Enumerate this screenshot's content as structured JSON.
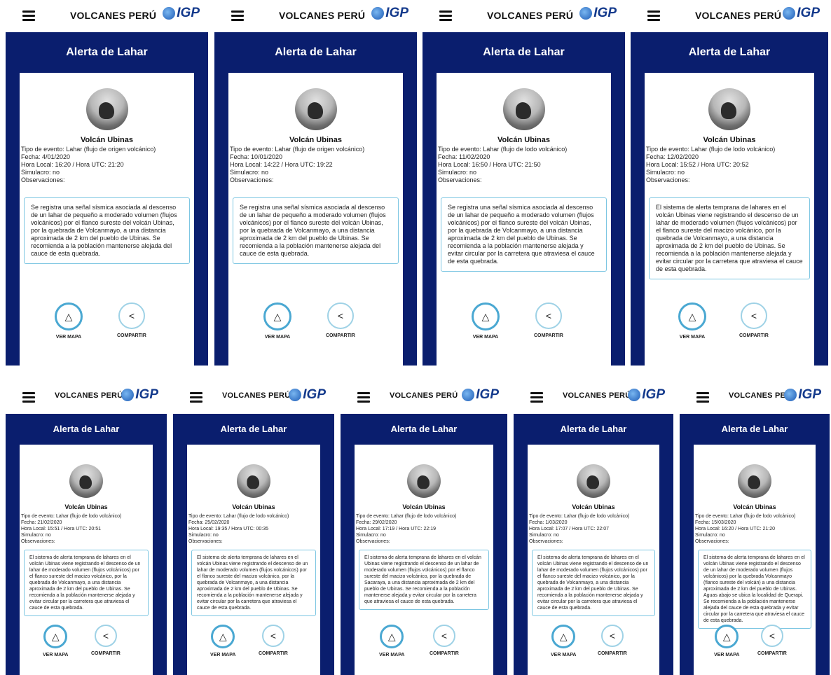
{
  "app": {
    "brand": "VOLCANES PERÚ",
    "logo_text": "IGP",
    "screen_title": "Alerta de Lahar",
    "menu_icon": "menu-icon"
  },
  "labels": {
    "map_button": "VER MAPA",
    "share_button": "COMPARTIR"
  },
  "icons": {
    "map": "map-icon",
    "share": "share-icon"
  },
  "colors": {
    "header_navy": "#0a1e6e",
    "accent": "#4aa8d2",
    "card": "#ffffff"
  },
  "screens": [
    {
      "volcano": "Volcán Ubinas",
      "event": "Tipo de evento: Lahar (flujo de origen volcánico)",
      "date": "Fecha: 4/01/2020",
      "time": "Hora Local: 16:20 / Hora UTC: 21:20",
      "drill": "Simulacro: no",
      "obs_label": "Observaciones:",
      "obs": "Se registra una señal sísmica asociada al descenso de un lahar de pequeño a moderado volumen (flujos volcánicos) por el flanco sureste del volcán Ubinas, por la quebrada de Volcanmayo, a una distancia aproximada de 2 km del pueblo de Ubinas. Se recomienda a la población mantenerse alejada del cauce de esta quebrada."
    },
    {
      "volcano": "Volcán Ubinas",
      "event": "Tipo de evento: Lahar (flujo de origen volcánico)",
      "date": "Fecha: 10/01/2020",
      "time": "Hora Local: 14:22 / Hora UTC: 19:22",
      "drill": "Simulacro: no",
      "obs_label": "Observaciones:",
      "obs": "Se registra una señal sísmica asociada al descenso de un lahar de pequeño a moderado volumen (flujos volcánicos) por el flanco sureste del volcán Ubinas, por la quebrada de Volcanmayo, a una distancia aproximada de 2 km del pueblo de Ubinas. Se recomienda a la población mantenerse alejada del cauce de esta quebrada."
    },
    {
      "volcano": "Volcán Ubinas",
      "event": "Tipo de evento: Lahar (flujo de lodo volcánico)",
      "date": "Fecha: 11/02/2020",
      "time": "Hora Local: 16:50 / Hora UTC: 21:50",
      "drill": "Simulacro: no",
      "obs_label": "Observaciones:",
      "obs": "Se registra una señal sísmica asociada al descenso de un lahar de pequeño a moderado volumen (flujos volcánicos) por el flanco sureste del volcán Ubinas, por la quebrada de Volcanmayo, a una distancia aproximada de 2 km del pueblo de Ubinas. Se recomienda a la población mantenerse alejada y evitar circular por la carretera que atraviesa el cauce de esta quebrada."
    },
    {
      "volcano": "Volcán Ubinas",
      "event": "Tipo de evento: Lahar (flujo de lodo volcánico)",
      "date": "Fecha: 12/02/2020",
      "time": "Hora Local: 15:52 / Hora UTC: 20:52",
      "drill": "Simulacro: no",
      "obs_label": "Observaciones:",
      "obs": "El sistema de alerta temprana de lahares en el volcán Ubinas viene registrando el descenso de un lahar de moderado volumen (flujos volcánicos) por el flanco sureste del macizo volcánico, por la quebrada de Volcanmayo, a una distancia aproximada de 2 km del pueblo de Ubinas. Se recomienda a la población mantenerse alejada y evitar circular por la carretera que atraviesa el cauce de esta quebrada."
    },
    {
      "volcano": "Volcán Ubinas",
      "event": "Tipo de evento: Lahar (flujo de lodo volcánico)",
      "date": "Fecha: 21/02/2020",
      "time": "Hora Local: 15:51 / Hora UTC: 20:51",
      "drill": "Simulacro: no",
      "obs_label": "Observaciones:",
      "obs": "El sistema de alerta temprana de lahares en el volcán Ubinas viene registrando el descenso de un lahar de moderado volumen (flujos volcánicos) por el flanco sureste del macizo volcánico, por la quebrada de Volcanmayo, a una distancia aproximada de 2 km del pueblo de Ubinas. Se recomienda a la población mantenerse alejada y evitar circular por la carretera que atraviesa el cauce de esta quebrada."
    },
    {
      "volcano": "Volcán Ubinas",
      "event": "Tipo de evento: Lahar (flujo de lodo volcánico)",
      "date": "Fecha: 25/02/2020",
      "time": "Hora Local: 19:35 / Hora UTC: 00:35",
      "drill": "Simulacro: no",
      "obs_label": "Observaciones:",
      "obs": "El sistema de alerta temprana de lahares en el volcán Ubinas viene registrando el descenso de un lahar de moderado volumen (flujos volcánicos) por el flanco sureste del macizo volcánico, por la quebrada de Volcanmayo, a una distancia aproximada de 2 km del pueblo de Ubinas. Se recomienda a la población mantenerse alejada y evitar circular por la carretera que atraviesa el cauce de esta quebrada."
    },
    {
      "volcano": "Volcán Ubinas",
      "event": "Tipo de evento: Lahar (flujo de lodo volcánico)",
      "date": "Fecha: 29/02/2020",
      "time": "Hora Local: 17:19 / Hora UTC: 22:19",
      "drill": "Simulacro: no",
      "obs_label": "Observaciones:",
      "obs": "El sistema de alerta temprana de lahares en el volcán Ubinas viene registrando el descenso de un lahar de moderado volumen (flujos volcánicos) por el flanco sureste del macizo volcánico, por la quebrada de Sacaraya, a una distancia aproximada de 2 km del pueblo de Ubinas. Se recomienda a la población mantenerse alejada y evitar circular por la carretera que atraviesa el cauce de esta quebrada."
    },
    {
      "volcano": "Volcán Ubinas",
      "event": "Tipo de evento: Lahar (flujo de lodo volcánico)",
      "date": "Fecha: 1/03/2020",
      "time": "Hora Local: 17:07 / Hora UTC: 22:07",
      "drill": "Simulacro: no",
      "obs_label": "Observaciones:",
      "obs": "El sistema de alerta temprana de lahares en el volcán Ubinas viene registrando el descenso de un lahar de moderado volumen (flujos volcánicos) por el flanco sureste del macizo volcánico, por la quebrada de Volcanmayo, a una distancia aproximada de 2 km del pueblo de Ubinas. Se recomienda a la población mantenerse alejada y evitar circular por la carretera que atraviesa el cauce de esta quebrada."
    },
    {
      "volcano": "Volcán Ubinas",
      "event": "Tipo de evento: Lahar (flujo de lodo volcánico)",
      "date": "Fecha: 15/03/2020",
      "time": "Hora Local: 16:20 / Hora UTC: 21:20",
      "drill": "Simulacro: no",
      "obs_label": "Observaciones:",
      "obs": "El sistema de alerta temprana de lahares en el volcán Ubinas viene registrando el descenso de un lahar de moderado volumen (flujos volcánicos) por la quebrada Volcanmayo (flanco sureste del volcán) a una distancia aproximada de 2 km del pueblo de Ubinas. Aguas abajo se ubica la localidad de Querapi. Se recomienda a la población mantenerse alejada del cauce de esta quebrada y evitar circular por la carretera que atraviesa el cauce de esta quebrada."
    }
  ]
}
